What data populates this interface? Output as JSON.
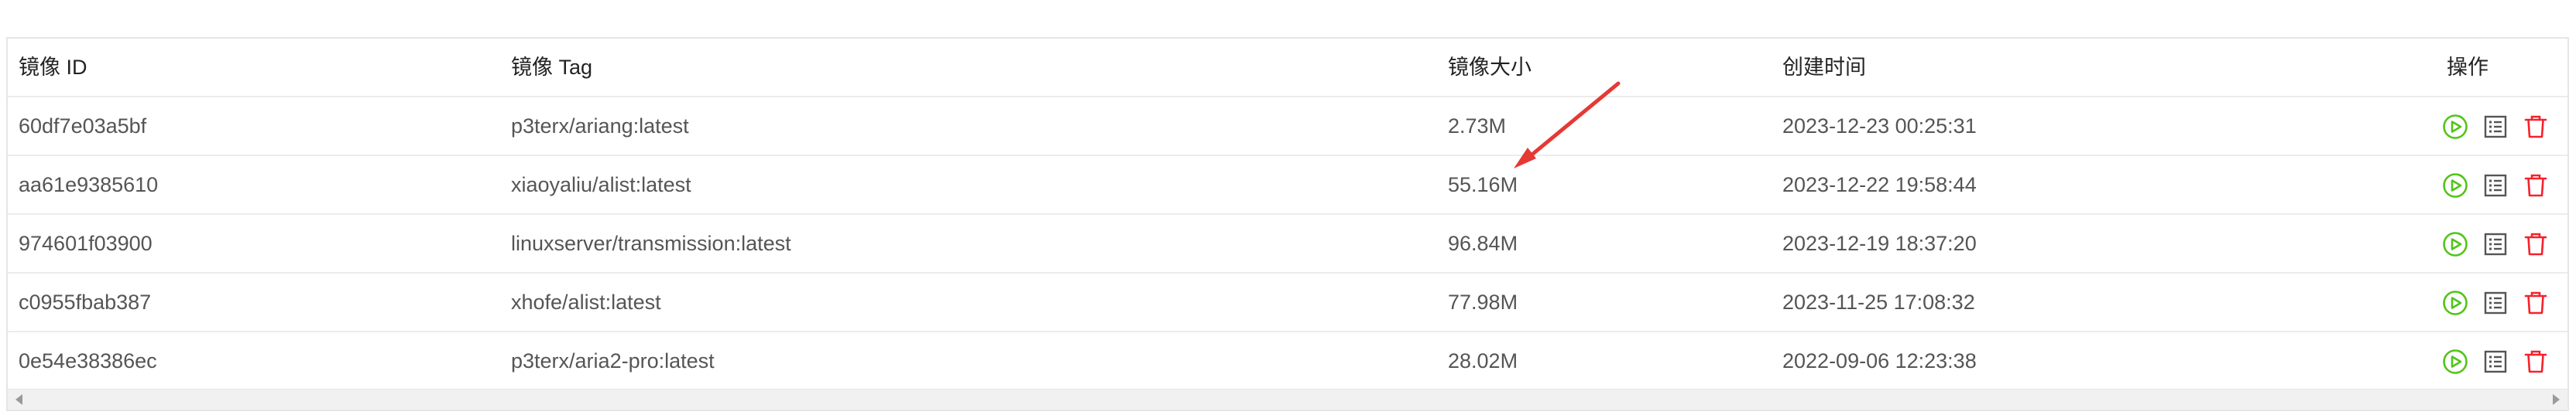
{
  "table": {
    "headers": {
      "id": "镜像 ID",
      "tag": "镜像 Tag",
      "size": "镜像大小",
      "created": "创建时间",
      "ops": "操作"
    },
    "rows": [
      {
        "id": "60df7e03a5bf",
        "tag": "p3terx/ariang:latest",
        "size": "2.73M",
        "created": "2023-12-23 00:25:31"
      },
      {
        "id": "aa61e9385610",
        "tag": "xiaoyaliu/alist:latest",
        "size": "55.16M",
        "created": "2023-12-22 19:58:44"
      },
      {
        "id": "974601f03900",
        "tag": "linuxserver/transmission:latest",
        "size": "96.84M",
        "created": "2023-12-19 18:37:20"
      },
      {
        "id": "c0955fbab387",
        "tag": "xhofe/alist:latest",
        "size": "77.98M",
        "created": "2023-11-25 17:08:32"
      },
      {
        "id": "0e54e38386ec",
        "tag": "p3terx/aria2-pro:latest",
        "size": "28.02M",
        "created": "2022-09-06 12:23:38"
      }
    ],
    "row_actions": [
      "play-icon",
      "list-icon",
      "trash-icon"
    ]
  },
  "colors": {
    "play": "#52c41a",
    "list": "#555555",
    "delete": "#f5222d",
    "annotation_arrow": "#e53935"
  }
}
